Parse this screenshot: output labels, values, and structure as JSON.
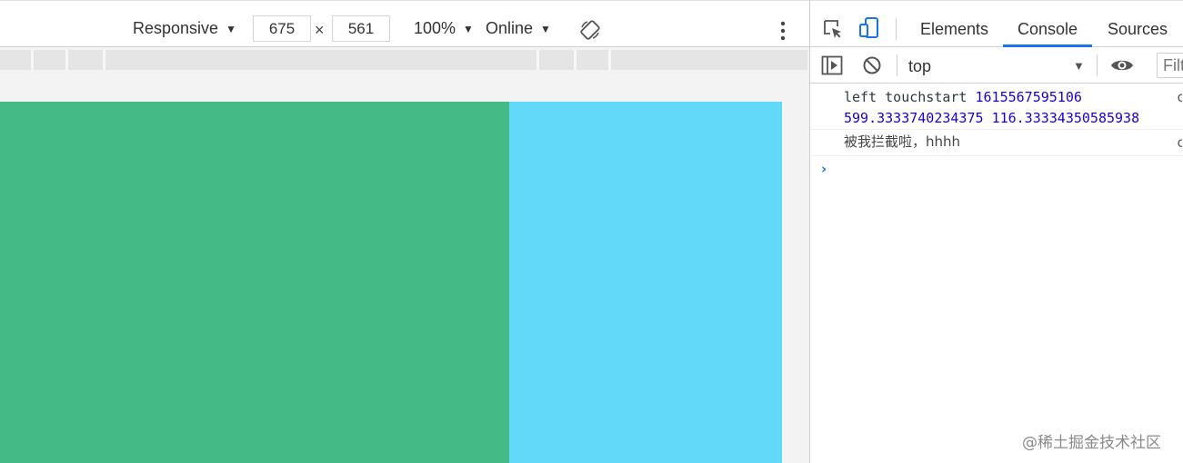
{
  "device_toolbar": {
    "device_label": "Responsive",
    "width_value": "675",
    "times_sign": "×",
    "height_value": "561",
    "zoom_label": "100%",
    "throttle_label": "Online",
    "caret": "▼"
  },
  "viewport": {
    "left_panel_color": "#44ba86",
    "right_panel_color": "#63d9f9"
  },
  "devtools": {
    "tabs": {
      "elements": "Elements",
      "console": "Console",
      "sources": "Sources"
    },
    "active_tab": "Console",
    "console_toolbar": {
      "context": "top",
      "caret": "▼",
      "filter_placeholder": "Filt"
    },
    "logs": [
      {
        "prefix": "left touchstart ",
        "timestamp": "1615567595106",
        "x": "599.3333740234375",
        "y": "116.33334350585938",
        "source": "c"
      },
      {
        "text": "被我拦截啦，hhhh",
        "source": "c"
      }
    ],
    "prompt": "›"
  },
  "watermark": "@稀土掘金技术社区",
  "colors": {
    "accent": "#1a73e8",
    "number": "#1c00cf"
  }
}
